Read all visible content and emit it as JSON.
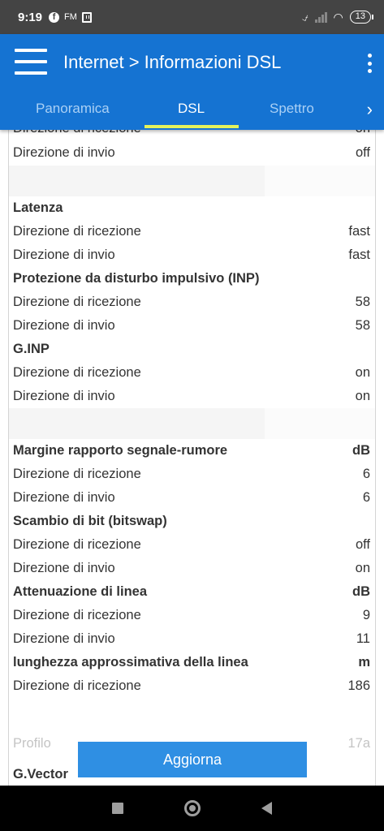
{
  "status_bar": {
    "time": "9:19",
    "fb_icon": "f",
    "fm_label": "FM",
    "mute_icon": "⍻",
    "wifi_icon": "◠",
    "battery": "13"
  },
  "header": {
    "title": "Internet > Informazioni DSL"
  },
  "tabs": [
    {
      "label": "Panoramica",
      "active": false
    },
    {
      "label": "DSL",
      "active": true
    },
    {
      "label": "Spettro",
      "active": false
    }
  ],
  "tab_next_icon": "›",
  "rows": [
    {
      "label": "Direzione di ricezione",
      "value": "on",
      "header": false
    },
    {
      "label": "Direzione di invio",
      "value": "off",
      "header": false
    },
    {
      "label": "Latenza",
      "value": "",
      "header": true
    },
    {
      "label": "Direzione di ricezione",
      "value": "fast",
      "header": false
    },
    {
      "label": "Direzione di invio",
      "value": "fast",
      "header": false
    },
    {
      "label": "Protezione da disturbo impulsivo (INP)",
      "value": "",
      "header": true
    },
    {
      "label": "Direzione di ricezione",
      "value": "58",
      "header": false
    },
    {
      "label": "Direzione di invio",
      "value": "58",
      "header": false
    },
    {
      "label": "G.INP",
      "value": "",
      "header": true
    },
    {
      "label": "Direzione di ricezione",
      "value": "on",
      "header": false
    },
    {
      "label": "Direzione di invio",
      "value": "on",
      "header": false
    },
    {
      "label": "Margine rapporto segnale-rumore",
      "value": "dB",
      "header": true
    },
    {
      "label": "Direzione di ricezione",
      "value": "6",
      "header": false
    },
    {
      "label": "Direzione di invio",
      "value": "6",
      "header": false
    },
    {
      "label": "Scambio di bit (bitswap)",
      "value": "",
      "header": true
    },
    {
      "label": "Direzione di ricezione",
      "value": "off",
      "header": false
    },
    {
      "label": "Direzione di invio",
      "value": "on",
      "header": false
    },
    {
      "label": "Attenuazione di linea",
      "value": "dB",
      "header": true
    },
    {
      "label": "Direzione di ricezione",
      "value": "9",
      "header": false
    },
    {
      "label": "Direzione di invio",
      "value": "11",
      "header": false
    },
    {
      "label": "lunghezza approssimativa della linea",
      "value": "m",
      "header": true
    },
    {
      "label": "Direzione di ricezione",
      "value": "186",
      "header": false
    },
    {
      "label": "Profilo",
      "value": "17a",
      "header": false
    },
    {
      "label": "G.Vector",
      "value": "",
      "header": true
    }
  ],
  "refresh_button": "Aggiorna",
  "colors": {
    "app_blue": "#1573d2",
    "tab_indicator": "#e4f25b",
    "button_blue": "#2f8fe3"
  }
}
